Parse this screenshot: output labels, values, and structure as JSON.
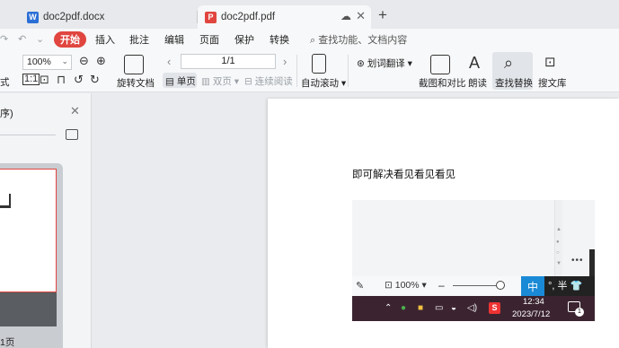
{
  "tabs": [
    {
      "label": "doc2pdf.docx",
      "icon": "word-file-icon",
      "active": false
    },
    {
      "label": "doc2pdf.pdf",
      "icon": "pdf-file-icon",
      "active": true
    }
  ],
  "new_tab_symbol": "+",
  "menu": {
    "items": [
      "开始",
      "插入",
      "批注",
      "编辑",
      "页面",
      "保护",
      "转换"
    ],
    "active": "开始",
    "search_label": "查找功能、文档内容"
  },
  "ribbon": {
    "format_label": "式",
    "zoom_value": "100%",
    "rotate_label": "旋转文档",
    "page_value": "1/1",
    "single_page_label": "单页",
    "double_page_label": "双页",
    "continuous_label": "连续阅读",
    "auto_scroll_label": "自动滚动",
    "translate_label": "划词翻译",
    "screenshot_compare_label": "截图和对比",
    "read_aloud_label": "朗读",
    "find_replace_label": "查找替换",
    "search_library_label": "搜文库"
  },
  "left_panel": {
    "title_fragment": "序)",
    "page_label_fragment": "1页"
  },
  "document": {
    "body_text": "即可解决看见看见看见",
    "embedded": {
      "zoom": "100%",
      "ime_mode": "中",
      "ime_extras": "°, 半",
      "time": "12:34",
      "date": "2023/7/12",
      "notification_count": "1",
      "sogou_symbol": "S"
    }
  },
  "colors": {
    "accent": "#e0463f",
    "word_blue": "#2b6fd6",
    "taskbar": "#3b2430",
    "ime_blue": "#1a8ad6"
  }
}
